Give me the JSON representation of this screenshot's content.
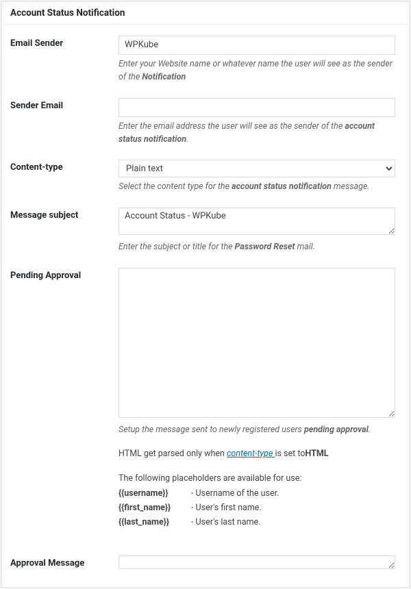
{
  "panel": {
    "title": "Account Status Notification"
  },
  "emailSender": {
    "label": "Email Sender",
    "value": "WPKube",
    "desc_prefix": "Enter your Website name or whatever name the user will see as the sender of the ",
    "desc_bold": "Notification"
  },
  "senderEmail": {
    "label": "Sender Email",
    "value": "",
    "desc_prefix": "Enter the email address the user will see as the sender of the ",
    "desc_bold": "account status notification",
    "desc_suffix": "."
  },
  "contentType": {
    "label": "Content-type",
    "selected": "Plain text",
    "desc_prefix": "Select the content type for the ",
    "desc_bold": "account status notification",
    "desc_suffix": " message."
  },
  "messageSubject": {
    "label": "Message subject",
    "value": "Account Status - WPKube",
    "desc_prefix": "Enter the subject or title for the ",
    "desc_bold": "Password Reset",
    "desc_suffix": " mail."
  },
  "pendingApproval": {
    "label": "Pending Approval",
    "value": "",
    "desc_prefix": "Setup the message sent to newly registered users ",
    "desc_bold": "pending approval",
    "desc_suffix": ".",
    "extra_prefix": "HTML get parsed only when ",
    "extra_link": "content-type ",
    "extra_suffix1": "is set to",
    "extra_suffix_bold": "HTML",
    "placeholders_intro": "The following placeholders are available for use:",
    "placeholders": [
      {
        "token": "{{username}}",
        "desc": "-   Username of the user."
      },
      {
        "token": "{{first_name}}",
        "desc": "-   User's first name."
      },
      {
        "token": "{{last_name}}",
        "desc": "-   User's last name."
      }
    ]
  },
  "approvalMessage": {
    "label": "Approval Message",
    "value": ""
  }
}
